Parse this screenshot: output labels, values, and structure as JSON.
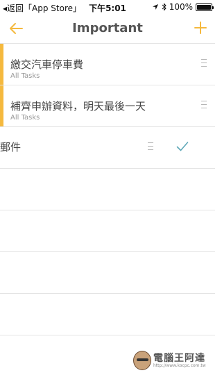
{
  "status_bar": {
    "back_label": "◂返回「App Store」",
    "time": "下午5:01",
    "battery": "100%"
  },
  "nav": {
    "title": "Important",
    "back_icon": "arrow-left-icon",
    "add_icon": "plus-icon"
  },
  "tasks": [
    {
      "title": "繳交汽車停車費",
      "list": "All Tasks",
      "flagged": true
    },
    {
      "title": "補齊申辦資料，明天最後一天",
      "list": "All Tasks",
      "flagged": true
    },
    {
      "title": "郵件",
      "list": "",
      "flagged": false,
      "completed_check": true
    }
  ],
  "watermark": {
    "text": "電腦王阿達",
    "url": "http://www.kocpc.com.tw"
  },
  "colors": {
    "accent": "#f5b93e",
    "check": "#5fa8b8",
    "separator": "#e4e4e4"
  }
}
